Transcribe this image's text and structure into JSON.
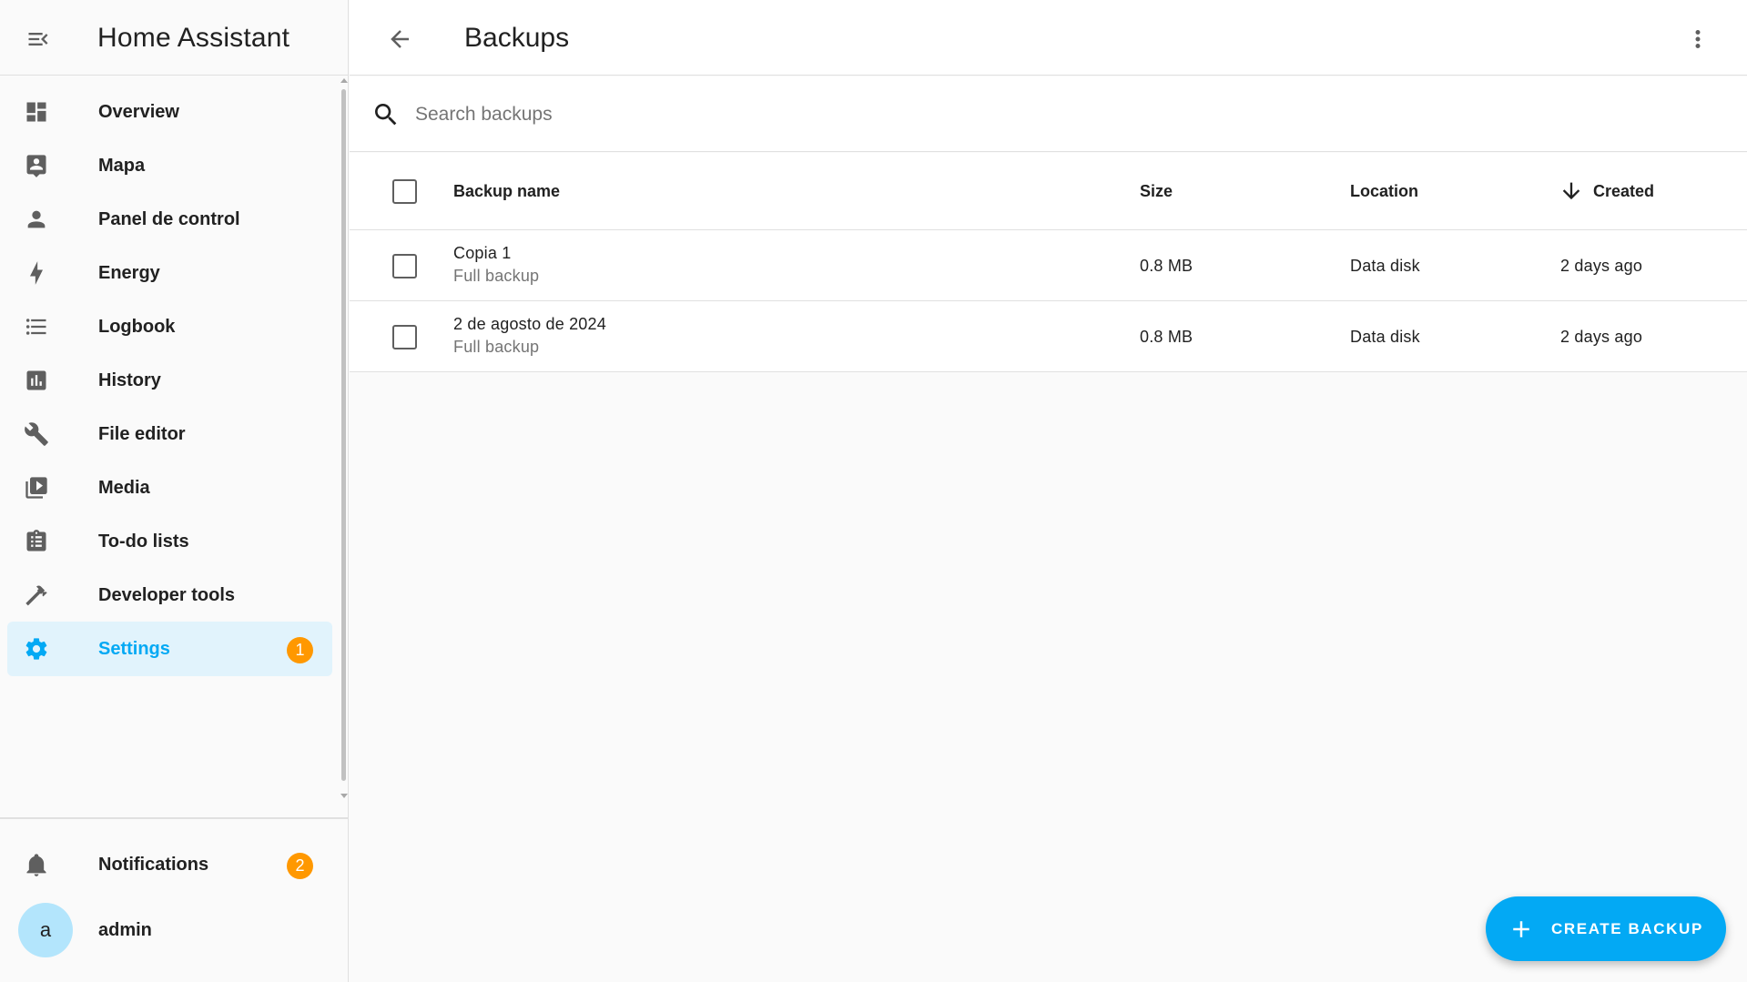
{
  "sidebar": {
    "title": "Home Assistant",
    "items": [
      {
        "label": "Overview",
        "icon": "dashboard-icon"
      },
      {
        "label": "Mapa",
        "icon": "map-account-icon"
      },
      {
        "label": "Panel de control",
        "icon": "account-icon"
      },
      {
        "label": "Energy",
        "icon": "lightning-bolt-icon"
      },
      {
        "label": "Logbook",
        "icon": "format-list-bulleted-icon"
      },
      {
        "label": "History",
        "icon": "chart-box-icon"
      },
      {
        "label": "File editor",
        "icon": "wrench-icon"
      },
      {
        "label": "Media",
        "icon": "play-box-multiple-icon"
      },
      {
        "label": "To-do lists",
        "icon": "clipboard-list-icon"
      },
      {
        "label": "Developer tools",
        "icon": "hammer-icon"
      },
      {
        "label": "Settings",
        "icon": "cog-icon",
        "badge": "1",
        "active": true
      }
    ],
    "notifications": {
      "label": "Notifications",
      "badge": "2",
      "icon": "bell-icon"
    },
    "user": {
      "label": "admin",
      "avatar_letter": "a"
    }
  },
  "header": {
    "title": "Backups"
  },
  "search": {
    "placeholder": "Search backups",
    "value": ""
  },
  "table": {
    "columns": {
      "name": "Backup name",
      "size": "Size",
      "location": "Location",
      "created": "Created"
    },
    "rows": [
      {
        "name": "Copia 1",
        "type": "Full backup",
        "size": "0.8 MB",
        "location": "Data disk",
        "created": "2 days ago"
      },
      {
        "name": "2 de agosto de 2024",
        "type": "Full backup",
        "size": "0.8 MB",
        "location": "Data disk",
        "created": "2 days ago"
      }
    ]
  },
  "fab": {
    "label": "CREATE BACKUP",
    "icon": "plus-icon"
  },
  "colors": {
    "accent": "#03a9f4",
    "badge": "#ff9800",
    "active_bg": "#e1f3fc",
    "avatar_bg": "#b3e5fc"
  }
}
